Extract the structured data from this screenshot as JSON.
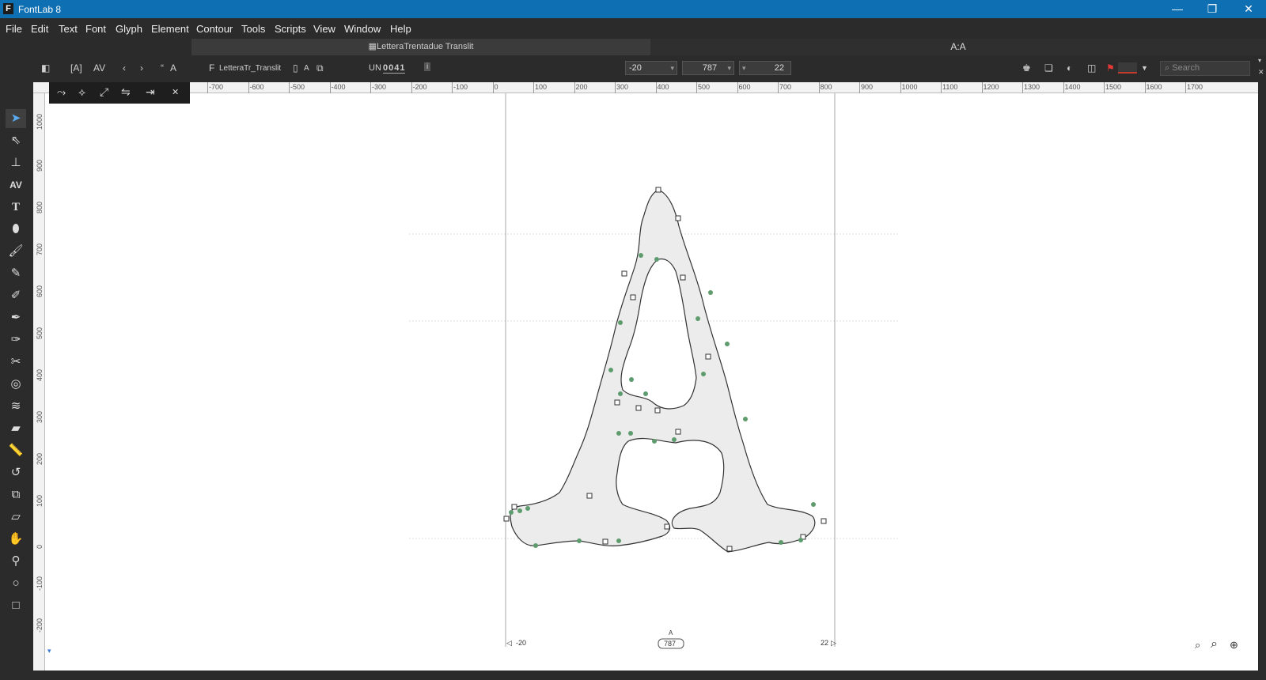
{
  "window": {
    "app_title": "FontLab 8",
    "app_icon_letter": "F",
    "minimize": "—",
    "restore": "❐",
    "close": "✕"
  },
  "menu": [
    "File",
    "Edit",
    "Text",
    "Font",
    "Glyph",
    "Element",
    "Contour",
    "Tools",
    "Scripts",
    "View",
    "Window",
    "Help"
  ],
  "tabs": {
    "font_tab": "LetteraTrentadue Translit",
    "glyph_tab": "A:A"
  },
  "toolbar": {
    "glyph_name": "A",
    "font_label": "LetteraTr_Translit",
    "layer_label": "A",
    "unicode_label": "UN",
    "unicode_value": "0041",
    "lsb": "-20",
    "advance": "787",
    "rsb": "22",
    "search_placeholder": "Search"
  },
  "ruler": {
    "h_labels": [
      "-700",
      "-600",
      "-500",
      "-400",
      "-300",
      "-200",
      "-100",
      "0",
      "100",
      "200",
      "300",
      "400",
      "500",
      "600",
      "700",
      "800",
      "900",
      "1000",
      "1100",
      "1200",
      "1300",
      "1400",
      "1500",
      "1600",
      "1700"
    ],
    "v_labels": [
      "1000",
      "900",
      "800",
      "700",
      "600",
      "500",
      "400",
      "300",
      "200",
      "100",
      "0",
      "-100",
      "-200"
    ]
  },
  "metrics": {
    "lsb_label": "-20",
    "advance_label": "787",
    "advance_glyph": "A",
    "rsb_label": "22"
  },
  "colors": {
    "titlebar": "#0f6fb3",
    "glyph_fill": "#ececec",
    "node_green": "#5e9c6e",
    "accent": "#5aaaf0"
  }
}
